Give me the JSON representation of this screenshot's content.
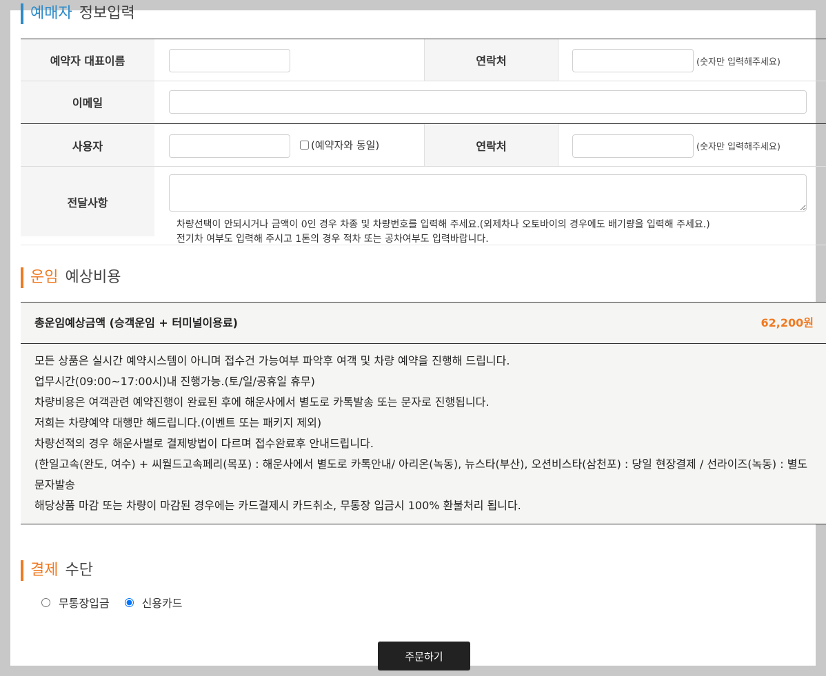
{
  "colors": {
    "booker_accent": "#2e8bc9",
    "fare_accent": "#f07a22",
    "payment_accent": "#f07a22",
    "price_text": "#f07a22",
    "button_bg": "#222222"
  },
  "booker_section": {
    "title_accent": "예매자",
    "title_rest": "정보입력"
  },
  "booker_form": {
    "rep_name_label": "예약자 대표이름",
    "rep_name_value": "",
    "rep_phone_label": "연락처",
    "rep_phone_value": "",
    "rep_phone_hint": "(숫자만 입력해주세요)",
    "email_label": "이메일",
    "email_value": "",
    "user_label": "사용자",
    "user_value": "",
    "same_as_booker_label": "(예약자와 동일)",
    "same_as_booker_checked": false,
    "user_phone_label": "연락처",
    "user_phone_value": "",
    "user_phone_hint": "(숫자만 입력해주세요)",
    "message_label": "전달사항",
    "message_value": "",
    "message_note_1": "차량선택이 안되시거나 금액이 0인 경우 차종 및 차량번호를 입력해 주세요.(외제차나 오토바이의 경우에도 배기량을 입력해 주세요.)",
    "message_note_2": "전기차 여부도 입력해 주시고 1톤의 경우 적차 또는 공차여부도 입력바랍니다."
  },
  "fare_section": {
    "title_accent": "운임",
    "title_rest": "예상비용",
    "total_label": "총운임예상금액 (승객운임 + 터미널이용료)",
    "total_value": "62,200원",
    "notices": [
      "모든 상품은 실시간 예약시스템이 아니며 접수건 가능여부 파악후 여객 및 차량 예약을 진행해 드립니다.",
      "업무시간(09:00~17:00시)내 진행가능.(토/일/공휴일 휴무)",
      "차량비용은 여객관련 예약진행이 완료된 후에 해운사에서 별도로 카톡발송 또는 문자로 진행됩니다.",
      "저희는 차량예약 대행만 해드립니다.(이벤트 또는 패키지 제외)",
      "차량선적의 경우 해운사별로 결제방법이 다르며 접수완료후 안내드립니다.",
      "(한일고속(완도, 여수) + 씨월드고속페리(목포) : 해운사에서 별도로 카톡안내/ 아리온(녹동), 뉴스타(부산), 오션비스타(삼천포) : 당일 현장결제 / 선라이즈(녹동) : 별도 문자발송",
      "해당상품 마감 또는 차량이 마감된 경우에는 카드결제시 카드취소, 무통장 입금시 100% 환불처리 됩니다."
    ]
  },
  "payment_section": {
    "title_accent": "결제",
    "title_rest": "수단",
    "options": [
      {
        "label": "무통장입금",
        "selected": false
      },
      {
        "label": "신용카드",
        "selected": true
      }
    ]
  },
  "order_button_label": "주문하기"
}
